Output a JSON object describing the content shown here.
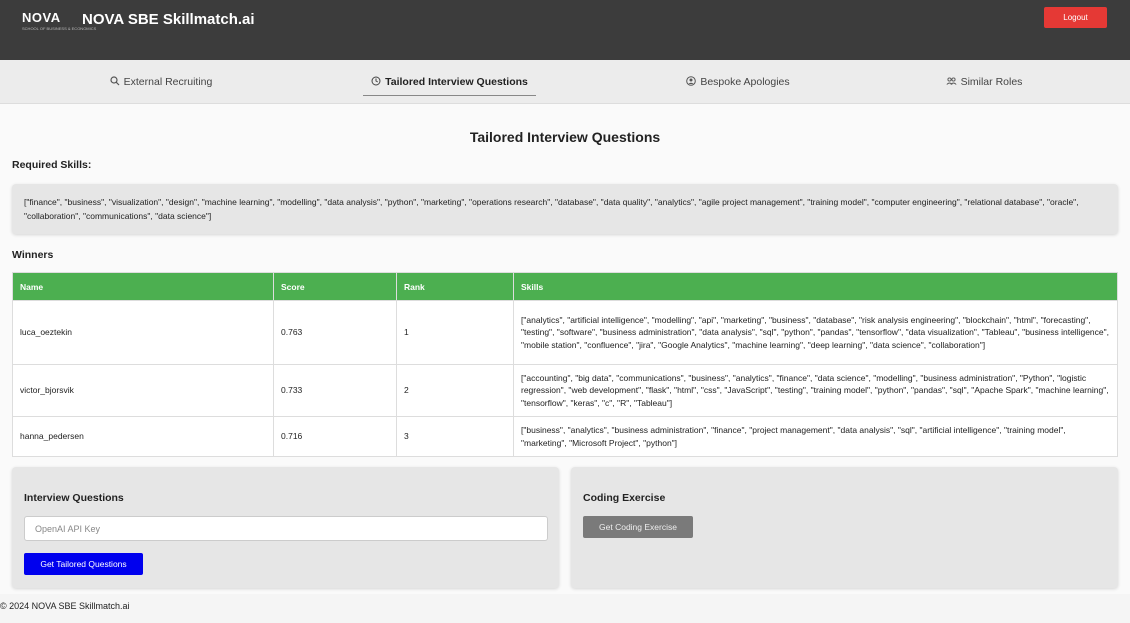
{
  "header": {
    "logo_text": "NOVA",
    "logo_sub": "SCHOOL OF BUSINESS & ECONOMICS",
    "title": "NOVA SBE Skillmatch.ai",
    "logout_label": "Logout"
  },
  "tabs": [
    {
      "label": "External Recruiting",
      "icon": "search-icon"
    },
    {
      "label": "Tailored Interview Questions",
      "icon": "clock-icon"
    },
    {
      "label": "Bespoke Apologies",
      "icon": "user-circle-icon"
    },
    {
      "label": "Similar Roles",
      "icon": "users-icon"
    }
  ],
  "main": {
    "title": "Tailored Interview Questions",
    "required_skills_label": "Required Skills:",
    "required_skills_text": "[\"finance\", \"business\", \"visualization\", \"design\", \"machine learning\", \"modelling\", \"data analysis\", \"python\", \"marketing\", \"operations research\", \"database\", \"data quality\", \"analytics\", \"agile project management\", \"training model\", \"computer engineering\", \"relational database\", \"oracle\", \"collaboration\", \"communications\", \"data science\"]",
    "winners_label": "Winners"
  },
  "table": {
    "headers": [
      "Name",
      "Score",
      "Rank",
      "Skills"
    ],
    "rows": [
      {
        "name": "luca_oeztekin",
        "score": "0.763",
        "rank": "1",
        "skills": "[\"analytics\", \"artificial intelligence\", \"modelling\", \"api\", \"marketing\", \"business\", \"database\", \"risk analysis engineering\", \"blockchain\", \"html\", \"forecasting\", \"testing\", \"software\", \"business administration\", \"data analysis\", \"sql\", \"python\", \"pandas\", \"tensorflow\", \"data visualization\", \"Tableau\", \"business intelligence\", \"mobile station\", \"confluence\", \"jira\", \"Google Analytics\", \"machine learning\", \"deep learning\", \"data science\", \"collaboration\"]"
      },
      {
        "name": "victor_bjorsvik",
        "score": "0.733",
        "rank": "2",
        "skills": "[\"accounting\", \"big data\", \"communications\", \"business\", \"analytics\", \"finance\", \"data science\", \"modelling\", \"business administration\", \"Python\", \"logistic regression\", \"web development\", \"flask\", \"html\", \"css\", \"JavaScript\", \"testing\", \"training model\", \"python\", \"pandas\", \"sql\", \"Apache Spark\", \"machine learning\", \"tensorflow\", \"keras\", \"c\", \"R\", \"Tableau\"]"
      },
      {
        "name": "hanna_pedersen",
        "score": "0.716",
        "rank": "3",
        "skills": "[\"business\", \"analytics\", \"business administration\", \"finance\", \"project management\", \"data analysis\", \"sql\", \"artificial intelligence\", \"training model\", \"marketing\", \"Microsoft Project\", \"python\"]"
      }
    ]
  },
  "interview_card": {
    "title": "Interview Questions",
    "api_key_placeholder": "OpenAI API Key",
    "button_label": "Get Tailored Questions"
  },
  "coding_card": {
    "title": "Coding Exercise",
    "button_label": "Get Coding Exercise"
  },
  "footer": {
    "text": "© 2024 NOVA SBE Skillmatch.ai"
  },
  "colors": {
    "topbar": "#3c3c3c",
    "logout": "#e53935",
    "table_header": "#4caf50",
    "primary_button": "#0000ee",
    "secondary_button": "#7a7a7a"
  }
}
